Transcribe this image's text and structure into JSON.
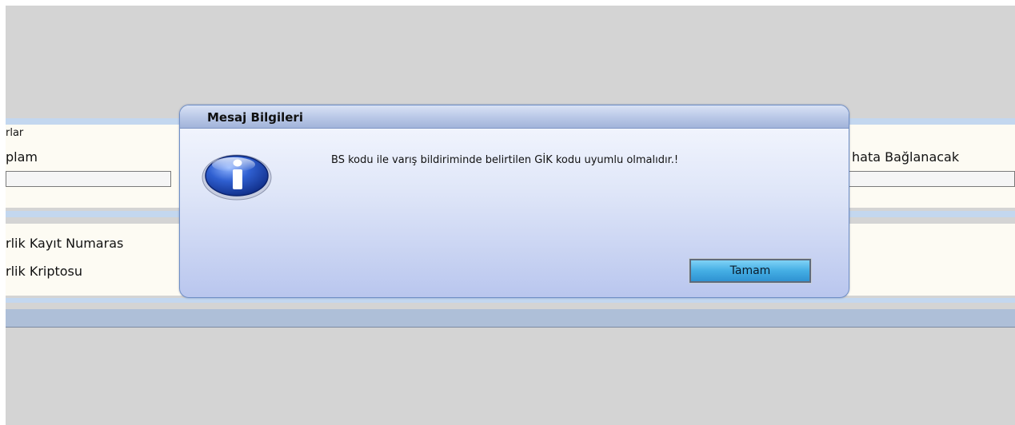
{
  "background_form": {
    "section_header": "rlar",
    "total_label": "plam",
    "right_label": "hata Bağlanacak",
    "registry_number_label": "rlik Kayıt Numaras",
    "crypto_label": "rlik Kriptosu"
  },
  "dialog": {
    "title": "Mesaj Bilgileri",
    "icon": "info-icon",
    "message": "BS kodu ile varış bildiriminde belirtilen GİK kodu uyumlu olmalıdır.!",
    "ok_label": "Tamam"
  },
  "colors": {
    "app_background": "#d4d4d4",
    "panel_background": "#fdfbf3",
    "stripe": "#c3d7ef",
    "dialog_border": "#6f8fc6",
    "button_blue": "#44aee4"
  }
}
